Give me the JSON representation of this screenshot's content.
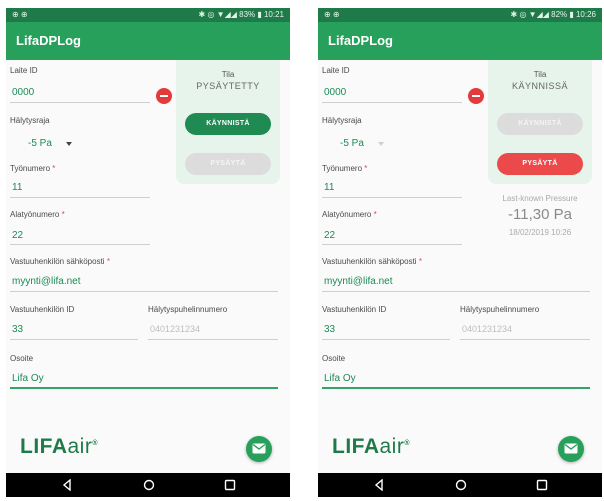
{
  "screens": [
    {
      "status_bar": {
        "left": "⊕ ⊕",
        "right": "✱ ◎ ▼◢◢ 83% ▮ 10:21"
      },
      "app_title": "LifaDPLog",
      "device_id": {
        "label": "Laite ID",
        "value": "0000"
      },
      "alarm_limit": {
        "label": "Hälytysraja",
        "value": "-5 Pa"
      },
      "work_number": {
        "label": "Työnumero",
        "required_mark": "*",
        "value": "11"
      },
      "sub_work_number": {
        "label": "Alatyönumero",
        "required_mark": "*",
        "value": "22"
      },
      "email": {
        "label": "Vastuuhenkilön sähköposti",
        "required_mark": "*",
        "value": "myynti@lifa.net"
      },
      "person_id": {
        "label": "Vastuuhenkilön ID",
        "value": "33"
      },
      "alarm_phone": {
        "label": "Hälytyspuhelinnumero",
        "placeholder": "0401231234"
      },
      "address": {
        "label": "Osoite",
        "value": "Lifa Oy"
      },
      "status_panel": {
        "heading": "Tila",
        "state": "PYSÄYTETTY",
        "start_button": "KÄYNNISTÄ",
        "stop_button": "PYSÄYTÄ"
      },
      "logo": {
        "bold": "LIFA",
        "thin": "air",
        "mark": "®"
      }
    },
    {
      "status_bar": {
        "left": "⊕ ⊕",
        "right": "✱ ◎ ▼◢◢ 82% ▮ 10:26"
      },
      "app_title": "LifaDPLog",
      "device_id": {
        "label": "Laite ID",
        "value": "0000"
      },
      "alarm_limit": {
        "label": "Hälytysraja",
        "value": "-5 Pa"
      },
      "work_number": {
        "label": "Työnumero",
        "required_mark": "*",
        "value": "11"
      },
      "sub_work_number": {
        "label": "Alatyönumero",
        "required_mark": "*",
        "value": "22"
      },
      "email": {
        "label": "Vastuuhenkilön sähköposti",
        "required_mark": "*",
        "value": "myynti@lifa.net"
      },
      "person_id": {
        "label": "Vastuuhenkilön ID",
        "value": "33"
      },
      "alarm_phone": {
        "label": "Hälytyspuhelinnumero",
        "placeholder": "0401231234"
      },
      "address": {
        "label": "Osoite",
        "value": "Lifa Oy"
      },
      "status_panel": {
        "heading": "Tila",
        "state": "KÄYNNISSÄ",
        "start_button": "KÄYNNISTÄ",
        "stop_button": "PYSÄYTÄ"
      },
      "pressure": {
        "label": "Last-known Pressure",
        "value": "-11,30 Pa",
        "timestamp": "18/02/2019 10:26"
      },
      "logo": {
        "bold": "LIFA",
        "thin": "air",
        "mark": "®"
      }
    }
  ],
  "colors": {
    "primary": "#27a05c",
    "dark": "#1f7a4a",
    "danger": "#ec4a4a",
    "field_text": "#1d8a55"
  }
}
